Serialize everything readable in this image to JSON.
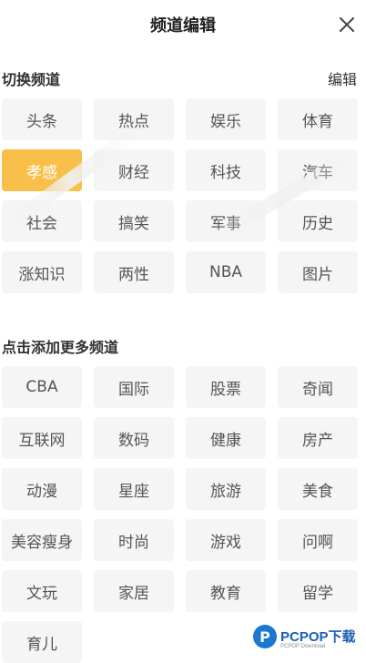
{
  "header": {
    "title": "频道编辑"
  },
  "switch_section": {
    "label": "切换频道",
    "edit_label": "编辑",
    "channels": [
      "头条",
      "热点",
      "娱乐",
      "体育",
      "孝感",
      "财经",
      "科技",
      "汽车",
      "社会",
      "搞笑",
      "军事",
      "历史",
      "涨知识",
      "两性",
      "NBA",
      "图片"
    ],
    "active_index": 4
  },
  "add_section": {
    "label": "点击添加更多频道",
    "channels": [
      "CBA",
      "国际",
      "股票",
      "奇闻",
      "互联网",
      "数码",
      "健康",
      "房产",
      "动漫",
      "星座",
      "旅游",
      "美食",
      "美容瘦身",
      "时尚",
      "游戏",
      "问啊",
      "文玩",
      "家居",
      "教育",
      "留学",
      "育儿"
    ]
  },
  "watermark": {
    "logo_letter": "P",
    "text": "PCPOP下载",
    "subtext": "PCPOP Download"
  },
  "colors": {
    "active_chip": "#f8c04a",
    "chip_bg": "#f5f5f5",
    "chip_text": "#555555"
  }
}
